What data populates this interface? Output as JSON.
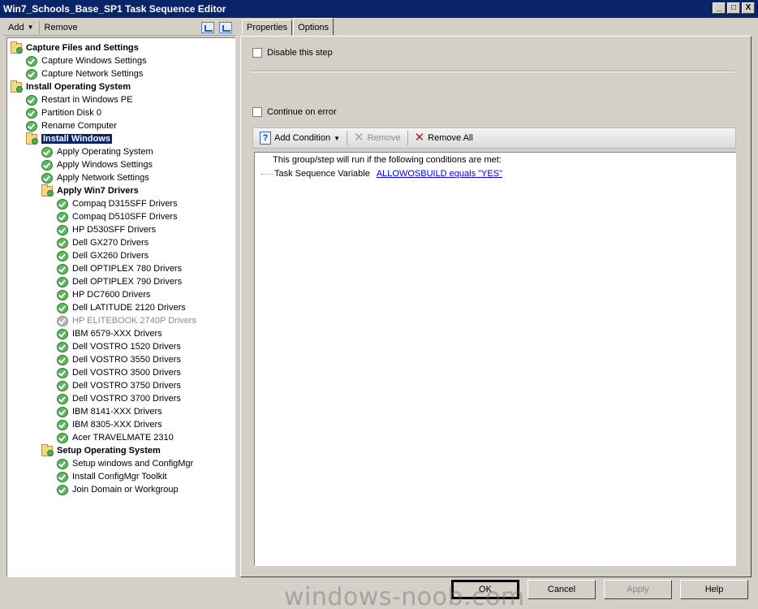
{
  "window": {
    "title": "Win7_Schools_Base_SP1 Task Sequence Editor",
    "controls": [
      "_",
      "□",
      "X"
    ]
  },
  "toolbar": {
    "add_label": "Add",
    "remove_label": "Remove",
    "icons": [
      "move-up-icon",
      "move-down-icon"
    ]
  },
  "tree": [
    {
      "label": "Capture Files and Settings",
      "level": 0,
      "kind": "group",
      "bold": true
    },
    {
      "label": "Capture Windows Settings",
      "level": 1,
      "kind": "step"
    },
    {
      "label": "Capture Network Settings",
      "level": 1,
      "kind": "step"
    },
    {
      "label": "Install Operating System",
      "level": 0,
      "kind": "group",
      "bold": true
    },
    {
      "label": "Restart in Windows PE",
      "level": 1,
      "kind": "step"
    },
    {
      "label": "Partition Disk 0",
      "level": 1,
      "kind": "step"
    },
    {
      "label": "Rename Computer",
      "level": 1,
      "kind": "step"
    },
    {
      "label": "Install Windows",
      "level": 1,
      "kind": "group",
      "bold": true,
      "selected": true
    },
    {
      "label": "Apply Operating System",
      "level": 2,
      "kind": "step"
    },
    {
      "label": "Apply Windows Settings",
      "level": 2,
      "kind": "step"
    },
    {
      "label": "Apply Network Settings",
      "level": 2,
      "kind": "step"
    },
    {
      "label": "Apply Win7 Drivers",
      "level": 2,
      "kind": "group",
      "bold": true
    },
    {
      "label": "Compaq D315SFF Drivers",
      "level": 3,
      "kind": "step"
    },
    {
      "label": "Compaq D510SFF Drivers",
      "level": 3,
      "kind": "step"
    },
    {
      "label": "HP D530SFF Drivers",
      "level": 3,
      "kind": "step"
    },
    {
      "label": "Dell GX270 Drivers",
      "level": 3,
      "kind": "step"
    },
    {
      "label": "Dell GX260 Drivers",
      "level": 3,
      "kind": "step"
    },
    {
      "label": "Dell OPTIPLEX 780 Drivers",
      "level": 3,
      "kind": "step"
    },
    {
      "label": "Dell OPTIPLEX 790 Drivers",
      "level": 3,
      "kind": "step"
    },
    {
      "label": "HP DC7600 Drivers",
      "level": 3,
      "kind": "step"
    },
    {
      "label": "Dell LATITUDE 2120 Drivers",
      "level": 3,
      "kind": "step"
    },
    {
      "label": "HP ELITEBOOK 2740P Drivers",
      "level": 3,
      "kind": "step",
      "disabled": true
    },
    {
      "label": "IBM 6579-XXX Drivers",
      "level": 3,
      "kind": "step"
    },
    {
      "label": "Dell VOSTRO 1520 Drivers",
      "level": 3,
      "kind": "step"
    },
    {
      "label": "Dell VOSTRO 3550 Drivers",
      "level": 3,
      "kind": "step"
    },
    {
      "label": "Dell VOSTRO 3500 Drivers",
      "level": 3,
      "kind": "step"
    },
    {
      "label": "Dell VOSTRO 3750 Drivers",
      "level": 3,
      "kind": "step"
    },
    {
      "label": "Dell VOSTRO 3700 Drivers",
      "level": 3,
      "kind": "step"
    },
    {
      "label": "IBM 8141-XXX Drivers",
      "level": 3,
      "kind": "step"
    },
    {
      "label": "IBM 8305-XXX Drivers",
      "level": 3,
      "kind": "step"
    },
    {
      "label": "Acer TRAVELMATE 2310",
      "level": 3,
      "kind": "step"
    },
    {
      "label": "Setup Operating System",
      "level": 2,
      "kind": "group",
      "bold": true
    },
    {
      "label": "Setup windows and ConfigMgr",
      "level": 3,
      "kind": "step"
    },
    {
      "label": "Install ConfigMgr Toolkit",
      "level": 3,
      "kind": "step"
    },
    {
      "label": "Join Domain or Workgroup",
      "level": 3,
      "kind": "step"
    }
  ],
  "tabs": [
    {
      "label": "Properties",
      "active": false
    },
    {
      "label": "Options",
      "active": true
    }
  ],
  "options": {
    "disable_label": "Disable this step",
    "disable_checked": false,
    "continue_label": "Continue on error",
    "continue_checked": false,
    "add_condition_label": "Add Condition",
    "remove_label": "Remove",
    "remove_all_label": "Remove All",
    "condition_header": "This group/step will run if the following conditions are met:",
    "condition_type": "Task Sequence Variable",
    "condition_value": "ALLOWOSBUILD equals \"YES\""
  },
  "buttons": {
    "ok": "OK",
    "cancel": "Cancel",
    "apply": "Apply",
    "help": "Help"
  },
  "watermark": "windows-noob.com",
  "colors": {
    "title_bar": "#0a246a",
    "selection": "#0a246a",
    "link": "#0000ee",
    "check_green": "#5cb85c",
    "remove_red": "#c8141e"
  }
}
